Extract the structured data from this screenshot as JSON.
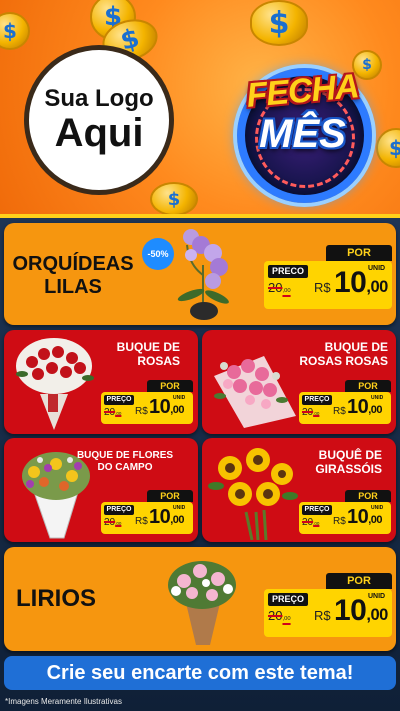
{
  "header": {
    "logo_line1": "Sua Logo",
    "logo_line2": "Aqui",
    "badge_line1": "FECHA",
    "badge_line2": "MÊS",
    "coin_symbol": "$"
  },
  "products": {
    "orquideas": {
      "name": "ORQUÍDEAS LILAS",
      "discount": "-50%",
      "preco_label": "PRECO",
      "por_label": "POR",
      "old_price": "20",
      "old_cents": ",00",
      "currency": "R$",
      "price": "10",
      "cents": ",00",
      "unit": "UNID"
    },
    "buque_rosas": {
      "name_line1": "BUQUE DE",
      "name_line2": "ROSAS",
      "preco_label": "PREÇO",
      "por_label": "POR",
      "old_price": "20",
      "old_cents": ",00",
      "currency": "R$",
      "price": "10",
      "cents": ",00",
      "unit": "UNID"
    },
    "buque_rosas_rosas": {
      "name_line1": "BUQUE DE",
      "name_line2": "ROSAS ROSAS",
      "preco_label": "PREÇO",
      "por_label": "POR",
      "old_price": "20",
      "old_cents": ",00",
      "currency": "R$",
      "price": "10",
      "cents": ",00",
      "unit": "UNID"
    },
    "buque_flores_campo": {
      "name_line1": "BUQUE DE FLORES",
      "name_line2": "DO CAMPO",
      "preco_label": "PREÇO",
      "por_label": "POR",
      "old_price": "20",
      "old_cents": ",00",
      "currency": "R$",
      "price": "10",
      "cents": ",00",
      "unit": "UNID"
    },
    "buque_girassois": {
      "name_line1": "BUQUÊ DE",
      "name_line2": "GIRASSÓIS",
      "preco_label": "PREÇO",
      "por_label": "POR",
      "old_price": "20",
      "old_cents": ",00",
      "currency": "R$",
      "price": "10",
      "cents": ",00",
      "unit": "UNID"
    },
    "lirios": {
      "name": "LIRIOS",
      "preco_label": "PREÇO",
      "por_label": "POR",
      "old_price": "20",
      "old_cents": ",00",
      "currency": "R$",
      "price": "10",
      "cents": ",00",
      "unit": "UNID"
    }
  },
  "cta": "Crie seu encarte com este tema!",
  "footnote": "*Imagens Meramente Ilustrativas",
  "colors": {
    "header_orange": "#f6960f",
    "card_red": "#cf0c14",
    "price_yellow": "#ffd400",
    "cta_blue": "#1f6fd6",
    "discount_blue": "#1e8cff"
  }
}
